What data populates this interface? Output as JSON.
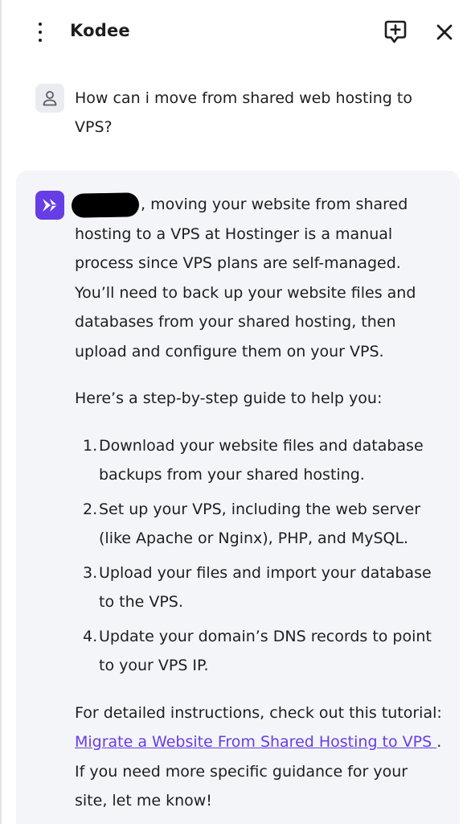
{
  "header": {
    "title": "Kodee",
    "menu_icon": "kebab-menu-icon",
    "new_chat_icon": "new-chat-icon",
    "close_icon": "close-icon"
  },
  "user_message": {
    "avatar_icon": "user-icon",
    "text": "How can i move from shared web hosting to VPS?"
  },
  "assistant_message": {
    "avatar_icon": "hostinger-logo-icon",
    "intro": ", moving your website from shared hosting to a VPS at Hostinger is a manual process since VPS plans are self-managed. You’ll need to back up your website files and databases from your shared hosting, then upload and configure them on your VPS.",
    "guide_intro": "Here’s a step-by-step guide to help you:",
    "steps": [
      {
        "num": "1.",
        "text": "Download your website files and database backups from your shared hosting."
      },
      {
        "num": "2.",
        "text": "Set up your VPS, including the web server (like Apache or Nginx), PHP, and MySQL."
      },
      {
        "num": "3.",
        "text": "Upload your files and import your database to the VPS."
      },
      {
        "num": "4.",
        "text": "Update your domain’s DNS records to point to your VPS IP."
      }
    ],
    "closing_before": "For detailed instructions, check out this tutorial: ",
    "link_text": "Migrate a Website From Shared Hosting to VPS ",
    "closing_after": ". If you need more specific guidance for your site, let me know!"
  },
  "colors": {
    "brand": "#673de6",
    "bubble_bg": "#f4f5f8",
    "text": "#1d1e20"
  }
}
